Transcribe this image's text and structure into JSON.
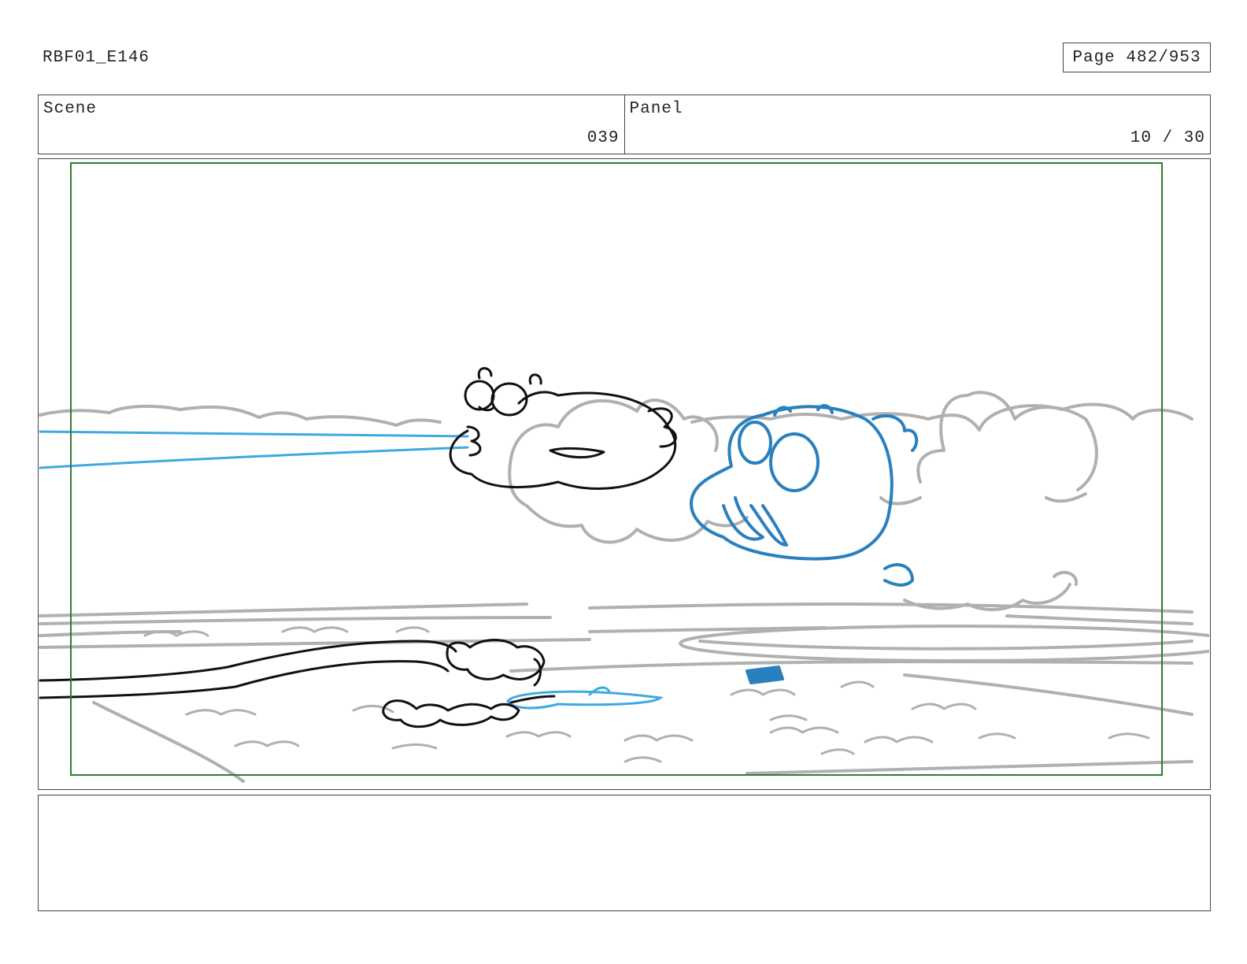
{
  "header": {
    "doc_id": "RBF01_E146",
    "page_label": "Page 482/953"
  },
  "info": {
    "scene_label": "Scene",
    "scene_value": "039",
    "panel_label": "Panel",
    "panel_value": "10 / 30"
  },
  "notes": {
    "text": ""
  },
  "colors": {
    "safe_frame": "#2e7d32",
    "background_sketch": "#b0b0b0",
    "ink": "#111111",
    "blue_character": "#2a7fbf",
    "water_beam": "#3fa9e0"
  }
}
